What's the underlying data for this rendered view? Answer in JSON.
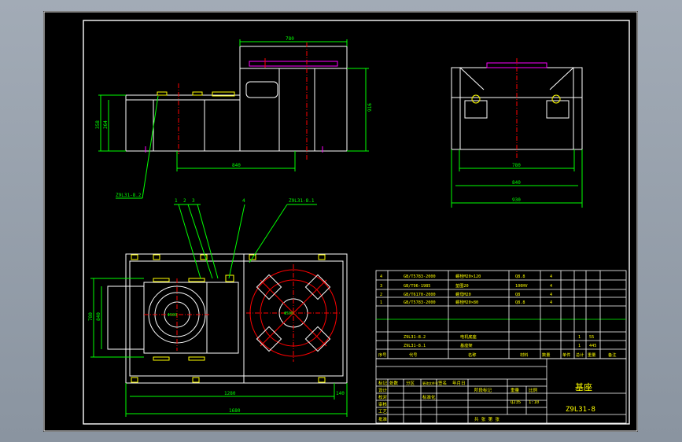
{
  "drawing": {
    "title_name": "基座",
    "drawing_number": "Z9L31-8",
    "scale": "1:10",
    "material_code": "Q235"
  },
  "colors": {
    "background": "#000000",
    "outline": "#ffffff",
    "dimension": "#00ff00",
    "centerline": "#ff0000",
    "hidden": "#ff00ff",
    "part": "#ffff00",
    "frame": "#ffffff"
  },
  "dimensions": {
    "top_width": "780",
    "front_height": "916",
    "front_left_height": "358",
    "front_left_height2": "364",
    "front_span": "840",
    "side_inner": "780",
    "side_mid": "840",
    "side_overall": "930",
    "plan_overall_1": "1280",
    "plan_overall_2": "1680",
    "plan_offset": "140",
    "plan_left_h1": "780",
    "plan_left_h2": "840"
  },
  "callouts": {
    "front_ref": "Z9L31-8.2",
    "plan_ref": "Z9L31-8.1",
    "bubbles": [
      "1",
      "2",
      "3",
      "4"
    ],
    "circle_label_left": "Φ500",
    "circle_label_right": "Φ500"
  },
  "bom": {
    "rows": [
      {
        "no": "4",
        "code": "GB/T5783-2000",
        "name": "螺栓M20×120",
        "qty": "4",
        "mat": "Q8.8"
      },
      {
        "no": "3",
        "code": "GB/T96-1985",
        "name": "垫圈20",
        "qty": "4",
        "mat": "100HV"
      },
      {
        "no": "2",
        "code": "GB/T6170-2000",
        "name": "螺母M20",
        "qty": "4",
        "mat": "Q8"
      },
      {
        "no": "1",
        "code": "GB/T5783-2000",
        "name": "螺栓M20×80",
        "qty": "4",
        "mat": "Q8.8"
      },
      {
        "no": "",
        "code": "Z9L31-8.2",
        "name": "电机底座",
        "qty": "1",
        "mat": "",
        "weight": "55"
      },
      {
        "no": "",
        "code": "Z9L31-8.1",
        "name": "基座架",
        "qty": "1",
        "mat": "",
        "weight": "445"
      }
    ],
    "header": [
      "序号",
      "代号",
      "名称",
      "数量",
      "材料",
      "单件",
      "总计",
      "重量",
      "备注"
    ]
  },
  "titleblock": {
    "left_labels": [
      "标记",
      "设计",
      "校对",
      "审核",
      "工艺",
      "批准"
    ],
    "col_labels": [
      "处数",
      "分区",
      "更改文件号",
      "签名",
      "年月日"
    ],
    "std_label": "标准化",
    "stage_label": "阶段标记",
    "weight_label": "重量",
    "scale_label": "比例",
    "sheet_label": "共 张 第 张"
  }
}
